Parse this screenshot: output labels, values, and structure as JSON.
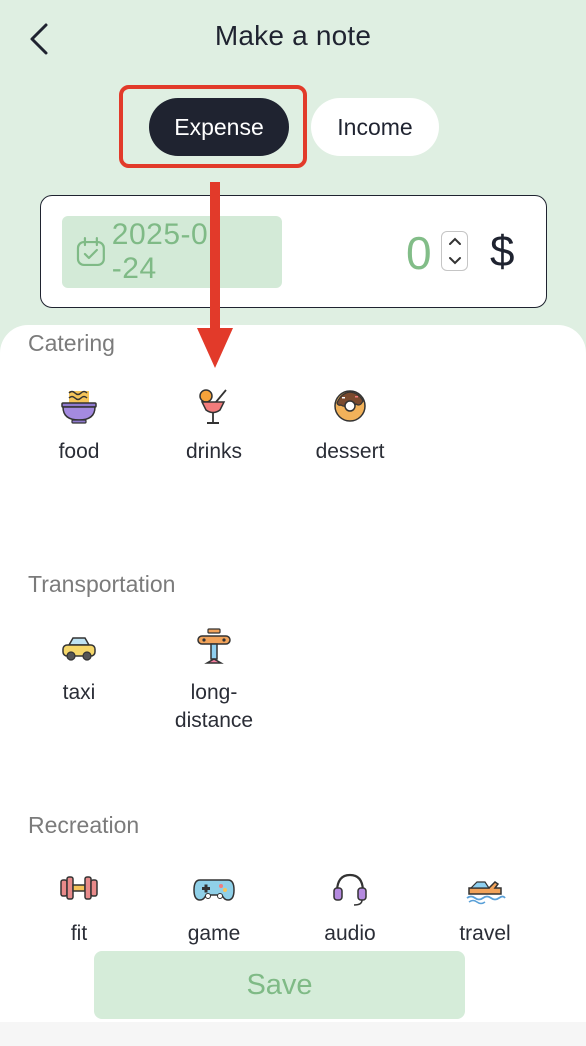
{
  "header": {
    "title": "Make a note"
  },
  "type_toggle": {
    "expense_label": "Expense",
    "income_label": "Income",
    "selected": "Expense"
  },
  "entry": {
    "date": "2025-0",
    "date_tail": "-24",
    "amount": "0",
    "currency": "$"
  },
  "sections": {
    "catering": {
      "title": "Catering",
      "items": [
        {
          "label": "food",
          "icon": "noodle-bowl-icon"
        },
        {
          "label": "drinks",
          "icon": "cocktail-icon"
        },
        {
          "label": "dessert",
          "icon": "donut-icon"
        }
      ]
    },
    "transportation": {
      "title": "Transportation",
      "items": [
        {
          "label": "taxi",
          "icon": "taxi-icon"
        },
        {
          "label": "long-",
          "label2": "distance",
          "icon": "airplane-icon"
        }
      ]
    },
    "recreation": {
      "title": "Recreation",
      "items": [
        {
          "label": "fit",
          "icon": "dumbbell-icon"
        },
        {
          "label": "game",
          "icon": "gamepad-icon"
        },
        {
          "label": "audio",
          "icon": "headphones-icon"
        },
        {
          "label": "travel",
          "icon": "jet-ski-icon"
        }
      ]
    }
  },
  "footer": {
    "save_label": "Save"
  },
  "colors": {
    "accent_green": "#7fba86",
    "header_bg": "#dfefe2",
    "dark": "#1f2330",
    "highlight_red": "#e23a2a"
  }
}
